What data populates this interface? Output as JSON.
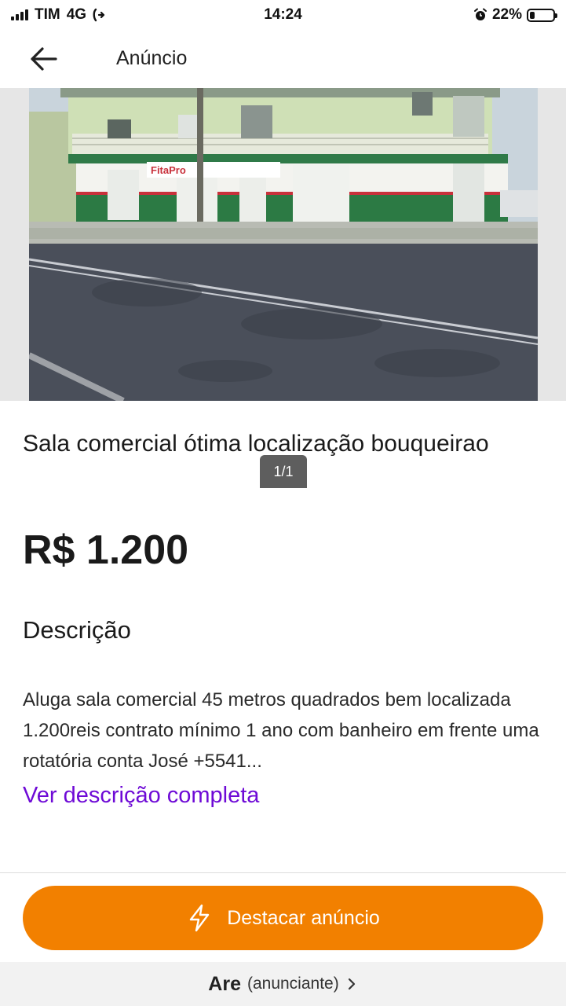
{
  "status_bar": {
    "carrier": "TIM",
    "network": "4G",
    "time": "14:24",
    "battery": "22%",
    "battery_level": 0.22
  },
  "header": {
    "title": "Anúncio",
    "back_icon": "arrow-left-icon"
  },
  "gallery": {
    "counter": "1/1",
    "photo_sign": "FitaPro"
  },
  "listing": {
    "title": "Sala comercial  ótima localização bouqueirao",
    "price": "R$ 1.200",
    "description_heading": "Descrição",
    "description": "Aluga sala comercial 45 metros quadrados bem localizada 1.200reis contrato mínimo 1 ano com banheiro em frente uma rotatória conta José +5541...",
    "see_full_description": "Ver descrição completa"
  },
  "cta": {
    "label": "Destacar anúncio",
    "icon": "lightning-icon"
  },
  "advertiser": {
    "name": "Are",
    "role": "(anunciante)",
    "icon": "chevron-right-icon"
  },
  "colors": {
    "accent_orange": "#f28000",
    "link_purple": "#6e0ad6"
  }
}
